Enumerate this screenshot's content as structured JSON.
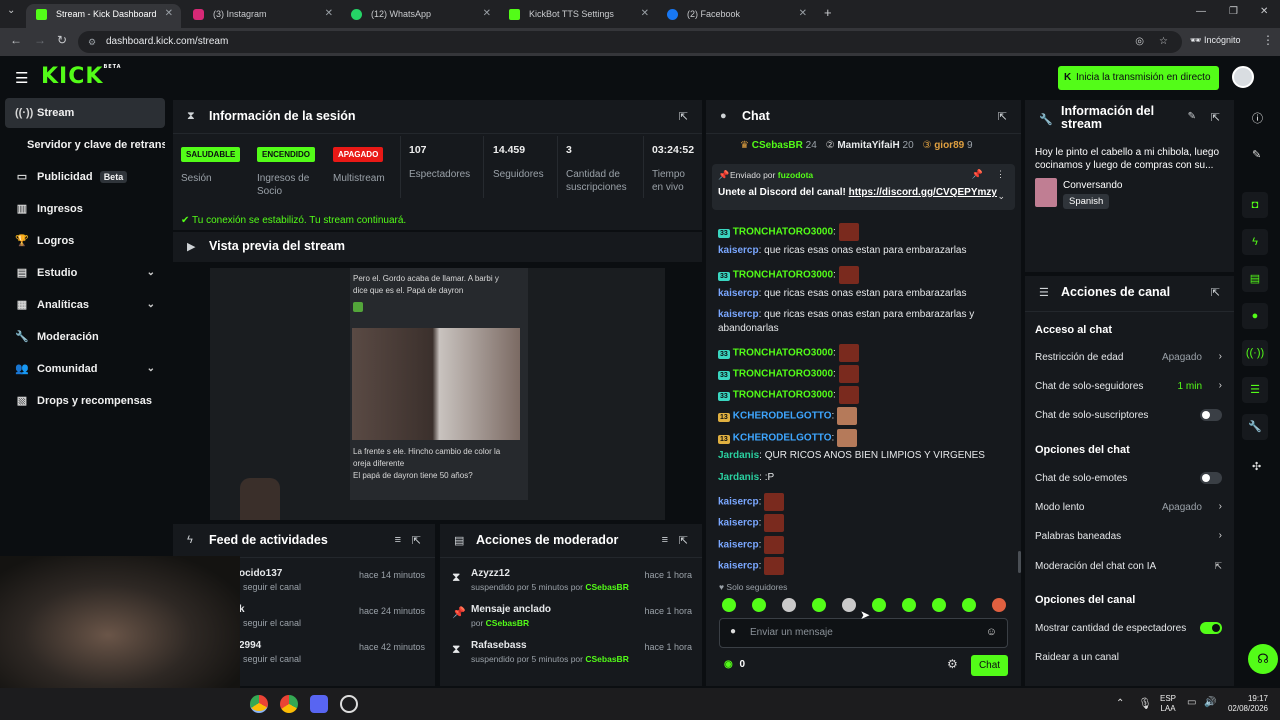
{
  "browser": {
    "tabs": [
      {
        "title": "Stream - Kick Dashboard",
        "color": "#53fc18"
      },
      {
        "title": "(3) Instagram",
        "color": "#d62976"
      },
      {
        "title": "(12) WhatsApp",
        "color": "#25d366"
      },
      {
        "title": "KickBot TTS Settings",
        "color": "#53fc18"
      },
      {
        "title": "(2) Facebook",
        "color": "#1877f2"
      }
    ],
    "url": "dashboard.kick.com/stream",
    "profile": "Incógnito"
  },
  "app": {
    "logo": "KICK",
    "logo_sup": "BETA",
    "start_stream_button": "Inicia la transmisión en directo"
  },
  "sidebar": {
    "items": [
      {
        "label": "Stream",
        "icon": "pulse-icon"
      },
      {
        "label": "Servidor y clave de retransmisión"
      },
      {
        "label": "Publicidad",
        "badge": "Beta",
        "icon": "billboard-icon"
      },
      {
        "label": "Ingresos",
        "icon": "chart-icon"
      },
      {
        "label": "Logros",
        "icon": "trophy-icon"
      },
      {
        "label": "Estudio",
        "icon": "studio-icon"
      },
      {
        "label": "Analíticas",
        "icon": "analytics-icon"
      },
      {
        "label": "Moderación",
        "icon": "wrench-icon"
      },
      {
        "label": "Comunidad",
        "icon": "community-icon"
      },
      {
        "label": "Drops y recompensas",
        "icon": "drops-icon"
      }
    ]
  },
  "session": {
    "title": "Información de la sesión",
    "health_badge": "SALUDABLE",
    "health_label": "Sesión",
    "partner_badge": "ENCENDIDO",
    "partner_label_1": "Ingresos de",
    "partner_label_2": "Socio",
    "multistream_badge": "APAGADO",
    "multistream_label": "Multistream",
    "viewers": "107",
    "viewers_label": "Espectadores",
    "followers": "14.459",
    "followers_label": "Seguidores",
    "subs": "3",
    "subs_label_1": "Cantidad de",
    "subs_label_2": "suscripciones",
    "uptime": "03:24:52",
    "uptime_label_1": "Tiempo",
    "uptime_label_2": "en vivo",
    "connection_msg": "Tu conexión se estabilizó. Tu stream continuará."
  },
  "preview": {
    "title": "Vista previa del stream",
    "caption_top_1": "Pero el. Gordo acaba de llamar. A barbi y",
    "caption_top_2": "dice que es el. Papá de dayron",
    "caption_bottom_1": "La frente s ele. Hincho cambio de color la",
    "caption_bottom_2": "oreja diferente",
    "caption_bottom_3": "El papá de dayron tiene 50 años?"
  },
  "activity": {
    "title": "Feed de actividades",
    "items": [
      {
        "name": "ocido137",
        "sub": "seguir el canal",
        "time": "hace 14 minutos"
      },
      {
        "name": "k",
        "sub": "seguir el canal",
        "time": "hace 24 minutos"
      },
      {
        "name": "2994",
        "sub": "seguir el canal",
        "time": "hace 42 minutos"
      }
    ]
  },
  "modactions": {
    "title": "Acciones de moderador",
    "items": [
      {
        "name": "Azyzz12",
        "sub": "suspendido por 5 minutos por",
        "by": "CSebasBR",
        "time": "hace 1 hora"
      },
      {
        "name": "Mensaje anclado",
        "sub": "por",
        "by": "CSebasBR",
        "time": "hace 1 hora"
      },
      {
        "name": "Rafasebass",
        "sub": "suspendido por 5 minutos por",
        "by": "CSebasBR",
        "time": "hace 1 hora"
      }
    ]
  },
  "chat": {
    "title": "Chat",
    "top_gifters": [
      {
        "name": "CSebasBR",
        "count": "24",
        "color": "#53fc18"
      },
      {
        "name": "MamitaYifaiH",
        "count": "20",
        "color": "#e6e8ea"
      },
      {
        "name": "gior89",
        "count": "9",
        "color": "#e0a040"
      }
    ],
    "pinned_sent_by": "Enviado por",
    "pinned_user": "fuzodota",
    "pinned_text": "Unete al Discord del canal!",
    "pinned_link": "https://discord.gg/CVQEPYmzy",
    "messages": [
      {
        "user": "TRONCHATORO3000",
        "badge": "33",
        "text": "",
        "emote": true,
        "color": "#53fc18"
      },
      {
        "user": "kaisercp",
        "text": "que ricas esas onas estan para embarazarlas",
        "color": "#7aa7ff"
      },
      {
        "user": "TRONCHATORO3000",
        "badge": "33",
        "text": "",
        "emote": true,
        "color": "#53fc18"
      },
      {
        "user": "kaisercp",
        "text": "que ricas esas onas estan para embarazarlas",
        "color": "#7aa7ff"
      },
      {
        "user": "kaisercp",
        "text": "que ricas esas onas estan para embarazarlas y",
        "cont": "abandonarlas",
        "color": "#7aa7ff"
      },
      {
        "user": "TRONCHATORO3000",
        "badge": "33",
        "text": "",
        "emote": true,
        "color": "#53fc18"
      },
      {
        "user": "TRONCHATORO3000",
        "badge": "33",
        "text": "",
        "emote": true,
        "color": "#53fc18"
      },
      {
        "user": "TRONCHATORO3000",
        "badge": "33",
        "text": "",
        "emote": true,
        "color": "#53fc18"
      },
      {
        "user": "KCHERODELGOTTO",
        "badge": "13",
        "text": "",
        "emote2": true,
        "color": "#3ea6ff"
      },
      {
        "user": "KCHERODELGOTTO",
        "badge": "13",
        "text": "",
        "emote2": true,
        "color": "#3ea6ff"
      },
      {
        "user": "Jardanis",
        "text": "QUR RICOS ANOS BIEN LIMPIOS Y VIRGENES",
        "color": "#2ad0a0"
      },
      {
        "user": "Jardanis",
        "text": ":P",
        "color": "#2ad0a0"
      },
      {
        "user": "kaisercp",
        "text": "",
        "emote": true,
        "color": "#7aa7ff"
      },
      {
        "user": "kaisercp",
        "text": "",
        "emote": true,
        "color": "#7aa7ff"
      },
      {
        "user": "kaisercp",
        "text": "",
        "emote": true,
        "color": "#7aa7ff"
      },
      {
        "user": "kaisercp",
        "text": "",
        "emote": true,
        "color": "#7aa7ff"
      }
    ],
    "followers_only": "Solo seguidores",
    "input_placeholder": "Enviar un mensaje",
    "points": "0",
    "send_button": "Chat"
  },
  "streaminfo": {
    "title_1": "Información del",
    "title_2": "stream",
    "description": "Hoy le pinto el cabello a mi chibola, luego cocinamos y luego de compras con su...",
    "category": "Conversando",
    "language": "Spanish"
  },
  "channel_actions": {
    "title": "Acciones de canal",
    "chat_access_heading": "Acceso al chat",
    "age_restriction": "Restricción de edad",
    "age_restriction_value": "Apagado",
    "followers_only": "Chat de solo-seguidores",
    "followers_only_value": "1 min",
    "subs_only": "Chat de solo-suscriptores",
    "chat_options_heading": "Opciones del chat",
    "emotes_only": "Chat de solo-emotes",
    "slow_mode": "Modo lento",
    "slow_mode_value": "Apagado",
    "banned_words": "Palabras baneadas",
    "ai_moderation": "Moderación del chat con IA",
    "channel_options_heading": "Opciones del canal",
    "show_viewers": "Mostrar cantidad de espectadores",
    "raid": "Raidear a un canal"
  },
  "taskbar": {
    "lang_1": "ESP",
    "lang_2": "LAA",
    "time": "19:17",
    "date": "02/08/2026"
  }
}
